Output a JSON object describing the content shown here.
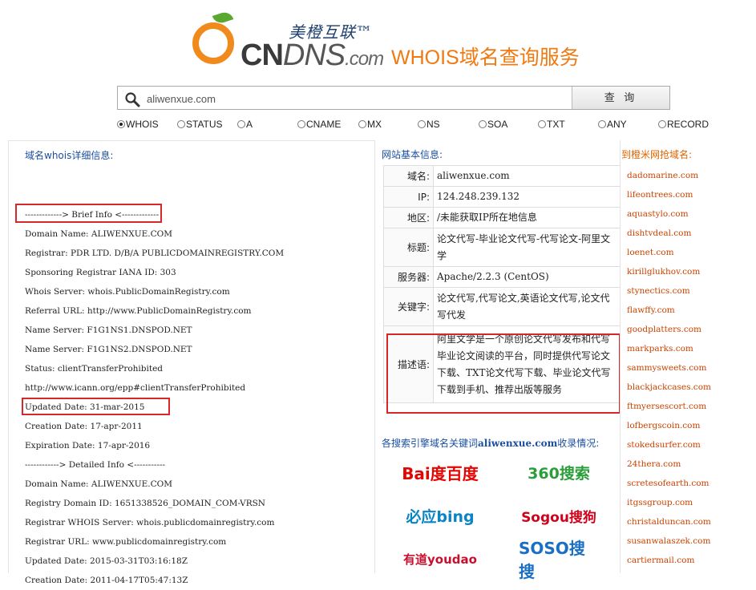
{
  "header": {
    "brand_cn": "美橙互联™",
    "brand_en": "CN",
    "brand_dns": "DNS",
    "brand_com": ".com",
    "title": "WHOIS域名查询服务"
  },
  "search": {
    "value": "aliwenxue.com",
    "button_label": "查 询"
  },
  "record_types": [
    {
      "label": "WHOIS",
      "selected": true
    },
    {
      "label": "STATUS",
      "selected": false
    },
    {
      "label": "A",
      "selected": false
    },
    {
      "label": "CNAME",
      "selected": false
    },
    {
      "label": "MX",
      "selected": false
    },
    {
      "label": "NS",
      "selected": false
    },
    {
      "label": "SOA",
      "selected": false
    },
    {
      "label": "TXT",
      "selected": false
    },
    {
      "label": "ANY",
      "selected": false
    },
    {
      "label": "RECORD",
      "selected": false
    }
  ],
  "whois": {
    "heading": "域名whois详细信息:",
    "lines": [
      "",
      "-------------> Brief Info <-------------",
      "Domain Name: ALIWENXUE.COM",
      "Registrar: PDR LTD. D/B/A PUBLICDOMAINREGISTRY.COM",
      "Sponsoring Registrar IANA ID: 303",
      "Whois Server: whois.PublicDomainRegistry.com",
      "Referral URL: http://www.PublicDomainRegistry.com",
      "Name Server: F1G1NS1.DNSPOD.NET",
      "Name Server: F1G1NS2.DNSPOD.NET",
      "Status: clientTransferProhibited",
      "http://www.icann.org/epp#clientTransferProhibited",
      "Updated Date: 31-mar-2015",
      "Creation Date: 17-apr-2011",
      "Expiration Date: 17-apr-2016",
      "------------> Detailed Info <-----------",
      "Domain Name: ALIWENXUE.COM",
      "Registry Domain ID: 1651338526_DOMAIN_COM-VRSN",
      "Registrar WHOIS Server: whois.publicdomainregistry.com",
      "Registrar URL: www.publicdomainregistry.com",
      "Updated Date: 2015-03-31T03:16:18Z",
      "Creation Date: 2011-04-17T05:47:13Z"
    ]
  },
  "site_info": {
    "heading": "网站基本信息:",
    "rows": [
      {
        "key": "域名:",
        "value": "aliwenxue.com"
      },
      {
        "key": "IP:",
        "value": "124.248.239.132"
      },
      {
        "key": "地区:",
        "value": "/未能获取IP所在地信息"
      },
      {
        "key": "标题:",
        "value": "论文代写-毕业论文代写-代写论文-阿里文学"
      },
      {
        "key": "服务器:",
        "value": "Apache/2.2.3 (CentOS)"
      },
      {
        "key": "关键字:",
        "value": "论文代写,代写论文,英语论文代写,论文代写代发"
      },
      {
        "key": "描述语:",
        "value": "阿里文学是一个原创论文代写发布和代写毕业论文阅读的平台，同时提供代写论文下载、TXT论文代写下载、毕业论文代写下载到手机、推荐出版等服务"
      }
    ]
  },
  "engines": {
    "heading_prefix": "各搜索引擎域名关键词",
    "heading_domain": "aliwenxue.com",
    "heading_suffix": "收录情况:",
    "items": [
      {
        "name": "Bai度百度",
        "color": "#e10602"
      },
      {
        "name": "360搜索",
        "color": "#2b9e3a"
      },
      {
        "name": "必应bing",
        "color": "#0a84c6"
      },
      {
        "name": "Sogou搜狗",
        "color": "#d0021b"
      },
      {
        "name": "有道youdao",
        "color": "#c8102e"
      },
      {
        "name": "SOSO搜搜",
        "color": "#1a6fc4"
      }
    ]
  },
  "grab": {
    "heading": "到橙米网抢域名:",
    "sites": [
      "dadomarine.com",
      "lifeontrees.com",
      "aquastylo.com",
      "dishtvdeal.com",
      "loenet.com",
      "kirillglukhov.com",
      "stynectics.com",
      "flawffy.com",
      "goodplatters.com",
      "markparks.com",
      "sammysweets.com",
      "blackjackcases.com",
      "ftmyersescort.com",
      "lofbergscoin.com",
      "stokedsurfer.com",
      "24thera.com",
      "scretesofearth.com",
      "itgssgroup.com",
      "christalduncan.com",
      "susanwalaszek.com",
      "cartiermail.com"
    ]
  }
}
